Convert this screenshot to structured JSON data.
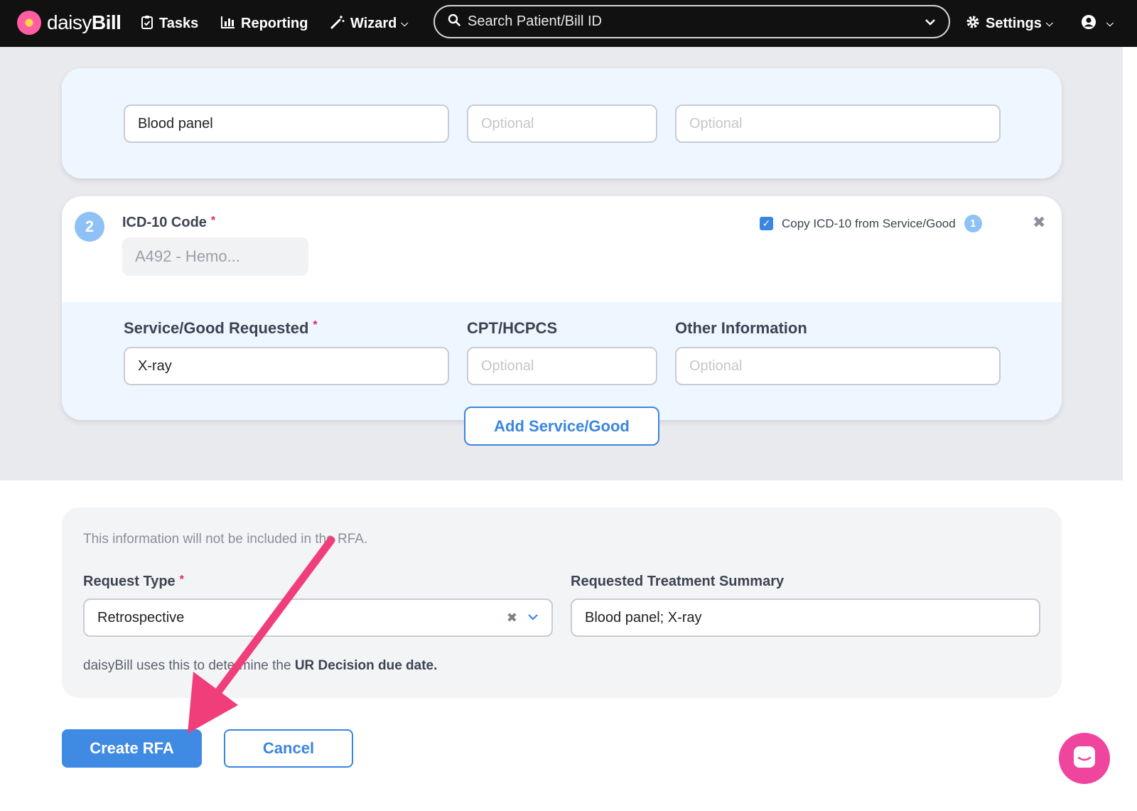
{
  "nav": {
    "logo_text": "daisy",
    "logo_text_bold": "Bill",
    "tasks": "Tasks",
    "reporting": "Reporting",
    "wizard": "Wizard",
    "search_placeholder": "Search Patient/Bill ID",
    "settings": "Settings"
  },
  "service_1": {
    "service_value": "Blood panel",
    "cpt_placeholder": "Optional",
    "other_placeholder": "Optional"
  },
  "service_2": {
    "number": "2",
    "icd_label": "ICD-10 Code",
    "icd_value": "A492 - Hemo...",
    "copy_label": "Copy ICD-10 from Service/Good",
    "copy_checked": true,
    "copy_badge": "1",
    "service_label": "Service/Good Requested",
    "service_value": "X-ray",
    "cpt_label": "CPT/HCPCS",
    "cpt_placeholder": "Optional",
    "other_label": "Other Information",
    "other_placeholder": "Optional"
  },
  "add_button": "Add Service/Good",
  "bottom": {
    "note": "This information will not be included in the RFA.",
    "request_type_label": "Request Type",
    "request_type_value": "Retrospective",
    "summary_label": "Requested Treatment Summary",
    "summary_value": "Blood panel; X-ray",
    "help_text": "daisyBill uses this to determine the ",
    "help_bold": "UR Decision due date."
  },
  "actions": {
    "create": "Create RFA",
    "cancel": "Cancel"
  },
  "colors": {
    "accent": "#3a86e0",
    "arrow": "#f03e7a",
    "chat": "#f0459d"
  }
}
